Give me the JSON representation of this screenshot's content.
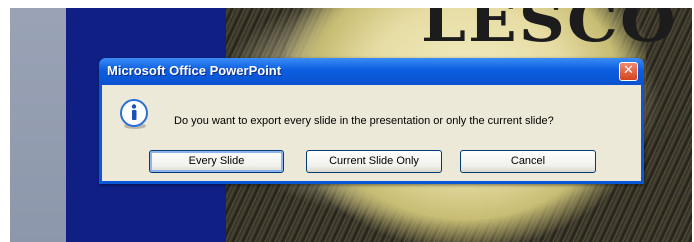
{
  "dialog": {
    "title": "Microsoft Office PowerPoint",
    "close_glyph": "✕",
    "message": "Do you want to export every slide in the presentation or only the current slide?",
    "icon": "info-icon",
    "buttons": {
      "every_slide": "Every Slide",
      "current_slide_only": "Current Slide Only",
      "cancel": "Cancel"
    }
  },
  "background": {
    "photo_text": "LESCO"
  },
  "colors": {
    "titlebar": "#0a58d8",
    "client": "#ece9d8",
    "close": "#d5431d",
    "slide_bg": "#0f1f86"
  }
}
